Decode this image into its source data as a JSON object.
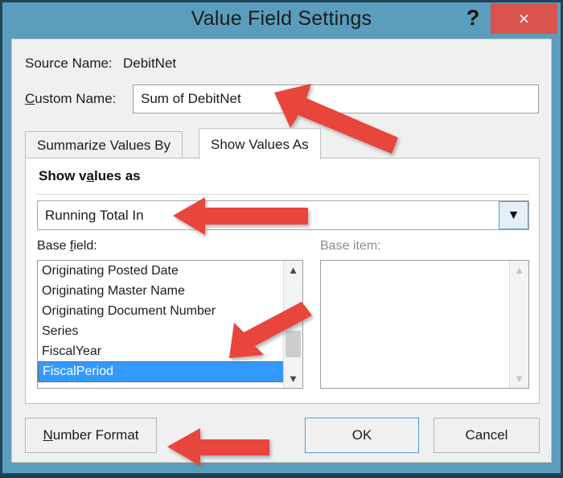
{
  "window": {
    "title": "Value Field Settings",
    "help_label": "?",
    "close_label": "×",
    "titlebar_color": "#5a9dbc",
    "close_color": "#d9534f"
  },
  "form": {
    "source_name_label": "Source Name:",
    "source_name_value": "DebitNet",
    "custom_name_label": "Custom Name:",
    "custom_name_value": "Sum of DebitNet"
  },
  "tabs": [
    {
      "label": "Summarize Values By",
      "active": false
    },
    {
      "label": "Show Values As",
      "active": true
    }
  ],
  "show_values_as": {
    "heading": "Show values as",
    "combo_value": "Running Total In",
    "combo_icon": "chevron-down-icon",
    "base_field_label": "Base field:",
    "base_item_label": "Base item:",
    "base_field_items": [
      "Originating Posted Date",
      "Originating Master Name",
      "Originating Document Number",
      "Series",
      "FiscalYear",
      "FiscalPeriod"
    ],
    "base_field_selected": "FiscalPeriod",
    "base_field_selected_color": "#3399ff",
    "base_item_items": []
  },
  "buttons": {
    "number_format": "Number Format",
    "ok": "OK",
    "cancel": "Cancel"
  },
  "annotations": {
    "arrow_color": "#e8453c",
    "arrows": [
      {
        "name": "arrow-to-custom-name",
        "points_to": "custom_name_value"
      },
      {
        "name": "arrow-to-show-values-combo",
        "points_to": "combo_value"
      },
      {
        "name": "arrow-to-base-field-selection",
        "points_to": "base_field_selected"
      },
      {
        "name": "arrow-to-number-format-button",
        "points_to": "number_format"
      }
    ]
  }
}
